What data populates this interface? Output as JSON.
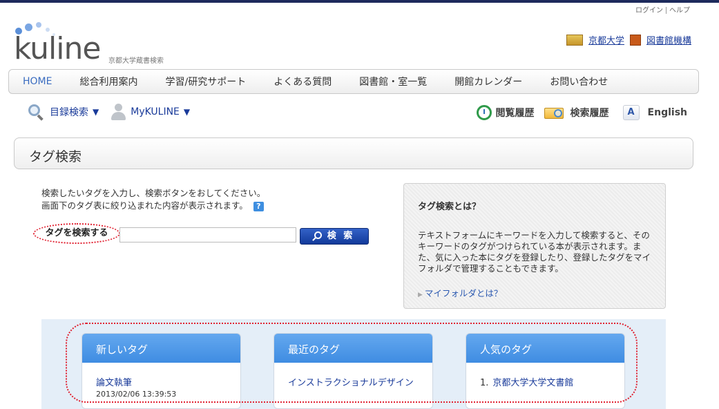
{
  "util": {
    "login": "ログイン",
    "help": "ヘルプ"
  },
  "logo": {
    "text": "kuline",
    "subtitle": "京都大学蔵書検索"
  },
  "univ_links": {
    "kyoto_univ": "京都大学",
    "library_network": "図書館機構"
  },
  "gnav": {
    "items": [
      "HOME",
      "総合利用案内",
      "学習/研究サポート",
      "よくある質問",
      "図書館・室一覧",
      "開館カレンダー",
      "お問い合わせ"
    ]
  },
  "subnav": {
    "catalog_search": "目録検索",
    "mykuline": "MyKULINE",
    "browse_history": "閲覧履歴",
    "search_history": "検索履歴",
    "english": "English"
  },
  "page": {
    "title": "タグ検索"
  },
  "instructions": {
    "line1": "検索したいタグを入力し、検索ボタンをおしてください。",
    "line2": "画面下のタグ表に絞り込まれた内容が表示されます。"
  },
  "search": {
    "label": "タグを検索する",
    "input_value": "",
    "button": "検 索"
  },
  "info": {
    "title": "タグ検索とは？",
    "body": "テキストフォームにキーワードを入力して検索すると、そのキーワードのタグがつけられている本が表示されます。また、気に入った本にタグを登録したり、登録したタグをマイフォルダで管理することもできます。",
    "link": "マイフォルダとは？"
  },
  "tags": {
    "new": {
      "title": "新しいタグ",
      "item": "論文執筆",
      "date": "2013/02/06 13:39:53"
    },
    "recent": {
      "title": "最近のタグ",
      "item": "インストラクショナルデザイン"
    },
    "popular": {
      "title": "人気のタグ",
      "rank": "1.",
      "item": "京都大学大学文書館"
    }
  },
  "colors": {
    "nav_blue": "#1a3b9a",
    "tag_header": "#4f98e8",
    "highlight": "#e02030"
  }
}
